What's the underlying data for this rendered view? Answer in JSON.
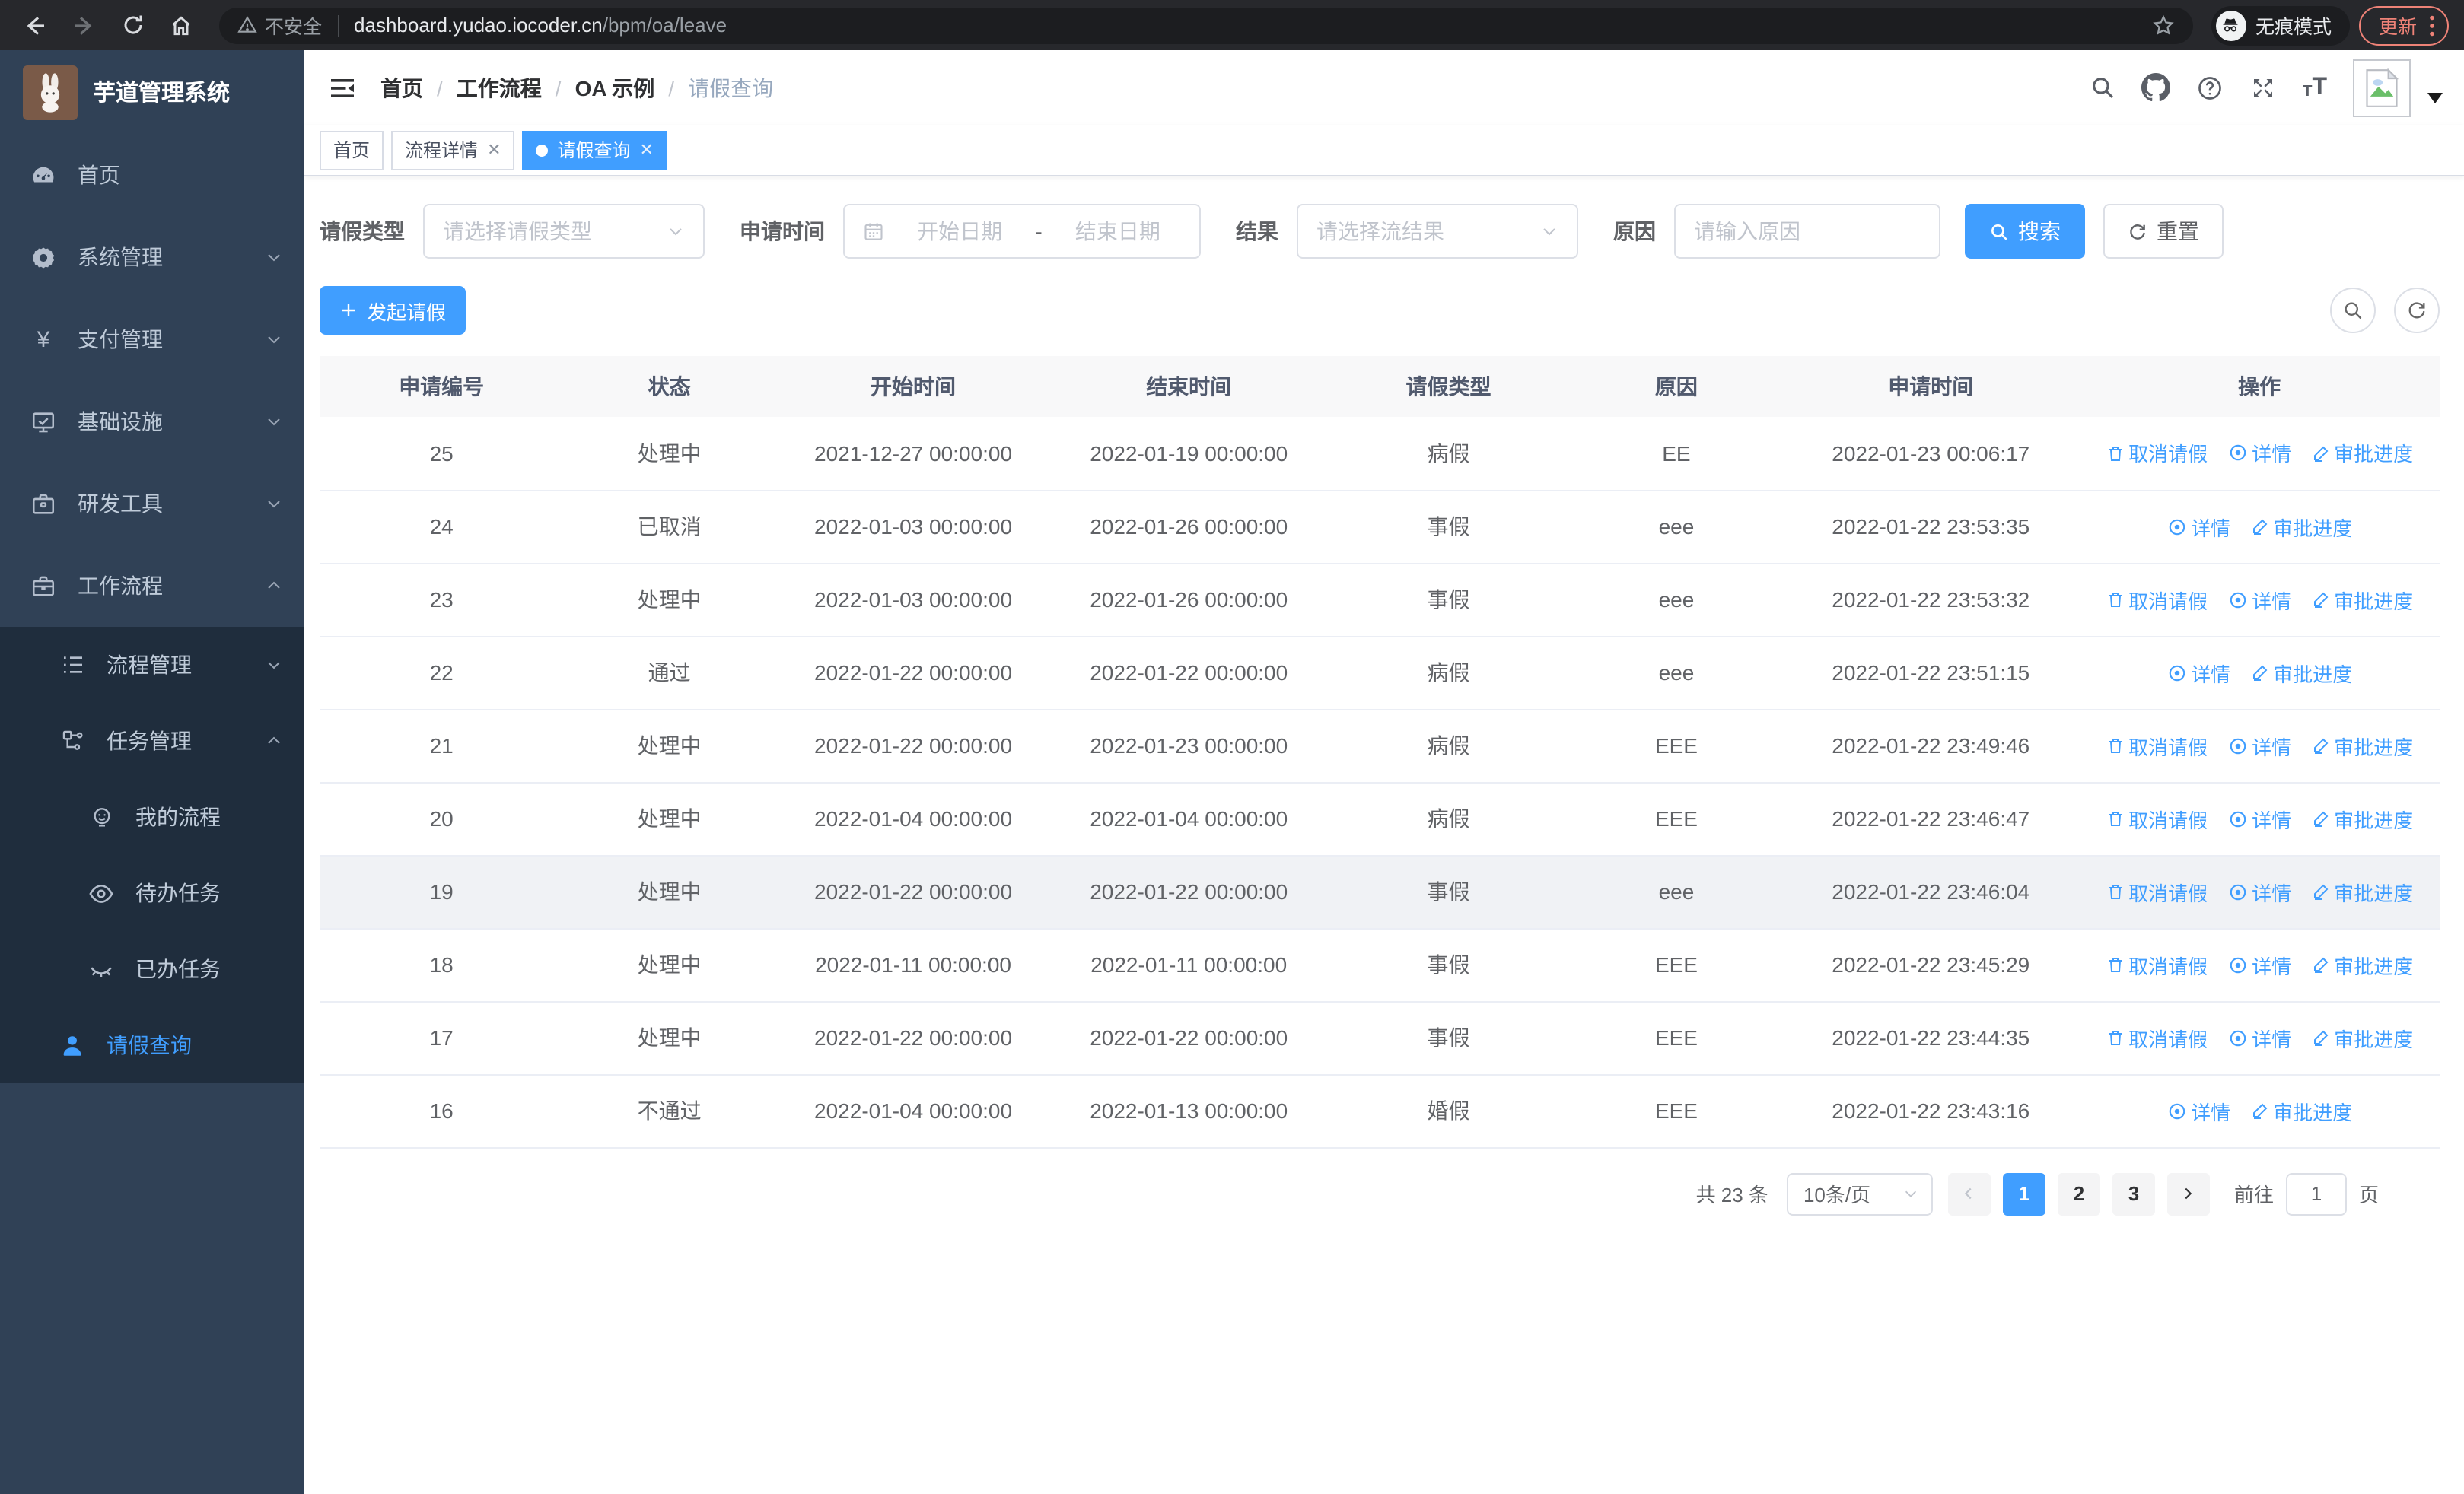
{
  "colors": {
    "accent": "#409eff",
    "sidebar_bg": "#304156",
    "submenu_bg": "#1f2d3d",
    "update_pill": "#ee8277",
    "chrome_bg": "#27282c"
  },
  "browser": {
    "security_label": "不安全",
    "url_host": "dashboard.yudao.iocoder.cn",
    "url_path": "/bpm/oa/leave",
    "incognito_label": "无痕模式",
    "update_label": "更新"
  },
  "sidebar": {
    "title": "芋道管理系统",
    "menu": {
      "home": "首页",
      "system": "系统管理",
      "pay": "支付管理",
      "infra": "基础设施",
      "devtool": "研发工具",
      "workflow": "工作流程",
      "process": "流程管理",
      "task": "任务管理",
      "my_process": "我的流程",
      "todo_task": "待办任务",
      "done_task": "已办任务",
      "leave_query": "请假查询"
    }
  },
  "navbar": {
    "breadcrumb": [
      "首页",
      "工作流程",
      "OA 示例",
      "请假查询"
    ]
  },
  "tabs": [
    {
      "label": "首页"
    },
    {
      "label": "流程详情"
    },
    {
      "label": "请假查询"
    }
  ],
  "filters": {
    "type_label": "请假类型",
    "type_placeholder": "请选择请假类型",
    "time_label": "申请时间",
    "start_placeholder": "开始日期",
    "range_separator": "-",
    "end_placeholder": "结束日期",
    "result_label": "结果",
    "result_placeholder": "请选择流结果",
    "reason_label": "原因",
    "reason_placeholder": "请输入原因",
    "search_label": "搜索",
    "reset_label": "重置"
  },
  "toolbar": {
    "create_label": "发起请假"
  },
  "table": {
    "columns": [
      "申请编号",
      "状态",
      "开始时间",
      "结束时间",
      "请假类型",
      "原因",
      "申请时间",
      "操作"
    ],
    "actions": {
      "cancel": "取消请假",
      "detail": "详情",
      "progress": "审批进度"
    },
    "rows": [
      {
        "id": "25",
        "status": "处理中",
        "start": "2021-12-27 00:00:00",
        "end": "2022-01-19 00:00:00",
        "type": "病假",
        "reason": "EE",
        "apply_time": "2022-01-23 00:06:17",
        "can_cancel": true,
        "highlight": false
      },
      {
        "id": "24",
        "status": "已取消",
        "start": "2022-01-03 00:00:00",
        "end": "2022-01-26 00:00:00",
        "type": "事假",
        "reason": "eee",
        "apply_time": "2022-01-22 23:53:35",
        "can_cancel": false,
        "highlight": false
      },
      {
        "id": "23",
        "status": "处理中",
        "start": "2022-01-03 00:00:00",
        "end": "2022-01-26 00:00:00",
        "type": "事假",
        "reason": "eee",
        "apply_time": "2022-01-22 23:53:32",
        "can_cancel": true,
        "highlight": false
      },
      {
        "id": "22",
        "status": "通过",
        "start": "2022-01-22 00:00:00",
        "end": "2022-01-22 00:00:00",
        "type": "病假",
        "reason": "eee",
        "apply_time": "2022-01-22 23:51:15",
        "can_cancel": false,
        "highlight": false
      },
      {
        "id": "21",
        "status": "处理中",
        "start": "2022-01-22 00:00:00",
        "end": "2022-01-23 00:00:00",
        "type": "病假",
        "reason": "EEE",
        "apply_time": "2022-01-22 23:49:46",
        "can_cancel": true,
        "highlight": false
      },
      {
        "id": "20",
        "status": "处理中",
        "start": "2022-01-04 00:00:00",
        "end": "2022-01-04 00:00:00",
        "type": "病假",
        "reason": "EEE",
        "apply_time": "2022-01-22 23:46:47",
        "can_cancel": true,
        "highlight": false
      },
      {
        "id": "19",
        "status": "处理中",
        "start": "2022-01-22 00:00:00",
        "end": "2022-01-22 00:00:00",
        "type": "事假",
        "reason": "eee",
        "apply_time": "2022-01-22 23:46:04",
        "can_cancel": true,
        "highlight": true
      },
      {
        "id": "18",
        "status": "处理中",
        "start": "2022-01-11 00:00:00",
        "end": "2022-01-11 00:00:00",
        "type": "事假",
        "reason": "EEE",
        "apply_time": "2022-01-22 23:45:29",
        "can_cancel": true,
        "highlight": false
      },
      {
        "id": "17",
        "status": "处理中",
        "start": "2022-01-22 00:00:00",
        "end": "2022-01-22 00:00:00",
        "type": "事假",
        "reason": "EEE",
        "apply_time": "2022-01-22 23:44:35",
        "can_cancel": true,
        "highlight": false
      },
      {
        "id": "16",
        "status": "不通过",
        "start": "2022-01-04 00:00:00",
        "end": "2022-01-13 00:00:00",
        "type": "婚假",
        "reason": "EEE",
        "apply_time": "2022-01-22 23:43:16",
        "can_cancel": false,
        "highlight": false
      }
    ]
  },
  "pagination": {
    "total_label": "共 23 条",
    "page_size": "10条/页",
    "pages": [
      "1",
      "2",
      "3"
    ],
    "goto_label": "前往",
    "goto_value": "1",
    "unit_label": "页"
  }
}
